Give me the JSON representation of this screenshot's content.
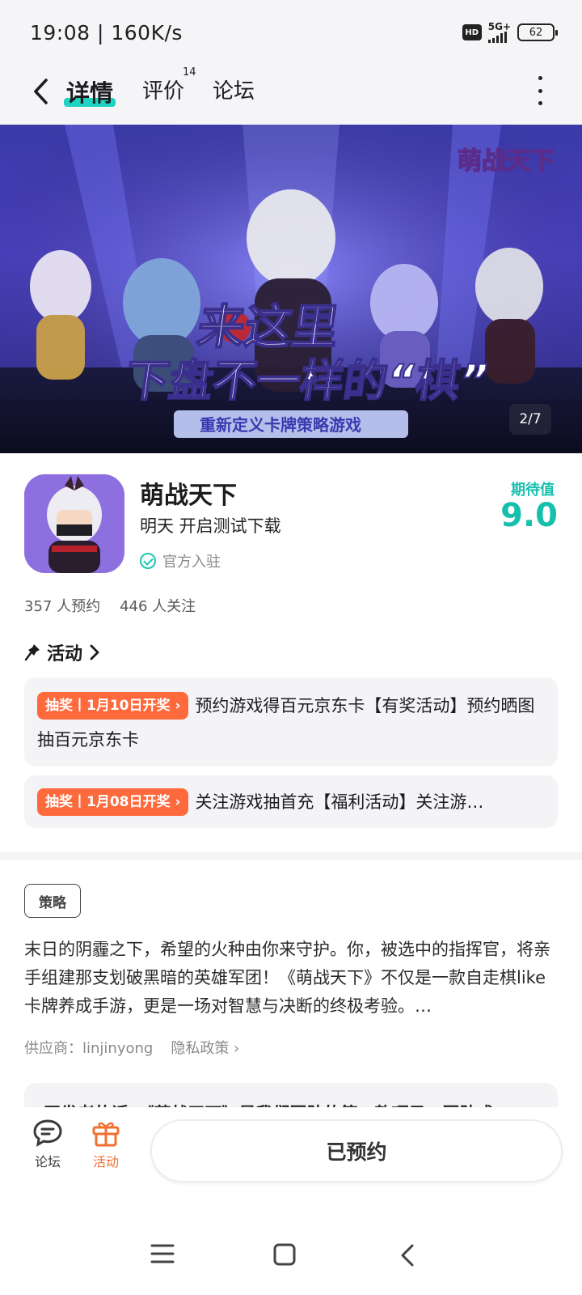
{
  "status_bar": {
    "time": "19:08 | 160K/s",
    "hd": "HD",
    "network": "5G+",
    "battery": "62"
  },
  "nav": {
    "tabs": [
      {
        "label": "详情"
      },
      {
        "label": "评价",
        "count": "14"
      },
      {
        "label": "论坛"
      }
    ]
  },
  "banner": {
    "logo_text": "萌战天下",
    "headline_1": "来这里",
    "headline_2": "下盘不一样的“棋”",
    "tagline": "重新定义卡牌策略游戏",
    "page_indicator": "2/7"
  },
  "app": {
    "name": "萌战天下",
    "subtitle": "明天 开启测试下载",
    "official": "官方入驻",
    "expect_label": "期待值",
    "expect_score": "9.0",
    "reservations": "357 人预约",
    "followers": "446 人关注"
  },
  "activity": {
    "title": "活动",
    "items": [
      {
        "badge": "抽奖丨1月10日开奖",
        "text": "预约游戏得百元京东卡【有奖活动】预约晒图抽百元京东卡"
      },
      {
        "badge": "抽奖丨1月08日开奖",
        "text": "关注游戏抽首充【福利活动】关注游…"
      }
    ]
  },
  "info": {
    "tag": "策略",
    "description": "末日的阴霾之下，希望的火种由你来守护。你，被选中的指挥官，将亲手组建那支划破黑暗的英雄军团！《萌战天下》不仅是一款自走棋like卡牌养成手游，更是一场对智慧与决断的终极考验。…",
    "vendor": "供应商：linjinyong",
    "privacy": "隐私政策"
  },
  "dev_note": "开发者的话：《萌战天下》是我们团队的第一款项目，团队成",
  "bottom_bar": {
    "forum_label": "论坛",
    "activity_label": "活动",
    "reserve_label": "已预约"
  },
  "colors": {
    "accent": "#1ed3c1",
    "score": "#16c0ad",
    "badge": "#ff6a3d",
    "activity_orange": "#f07030"
  }
}
